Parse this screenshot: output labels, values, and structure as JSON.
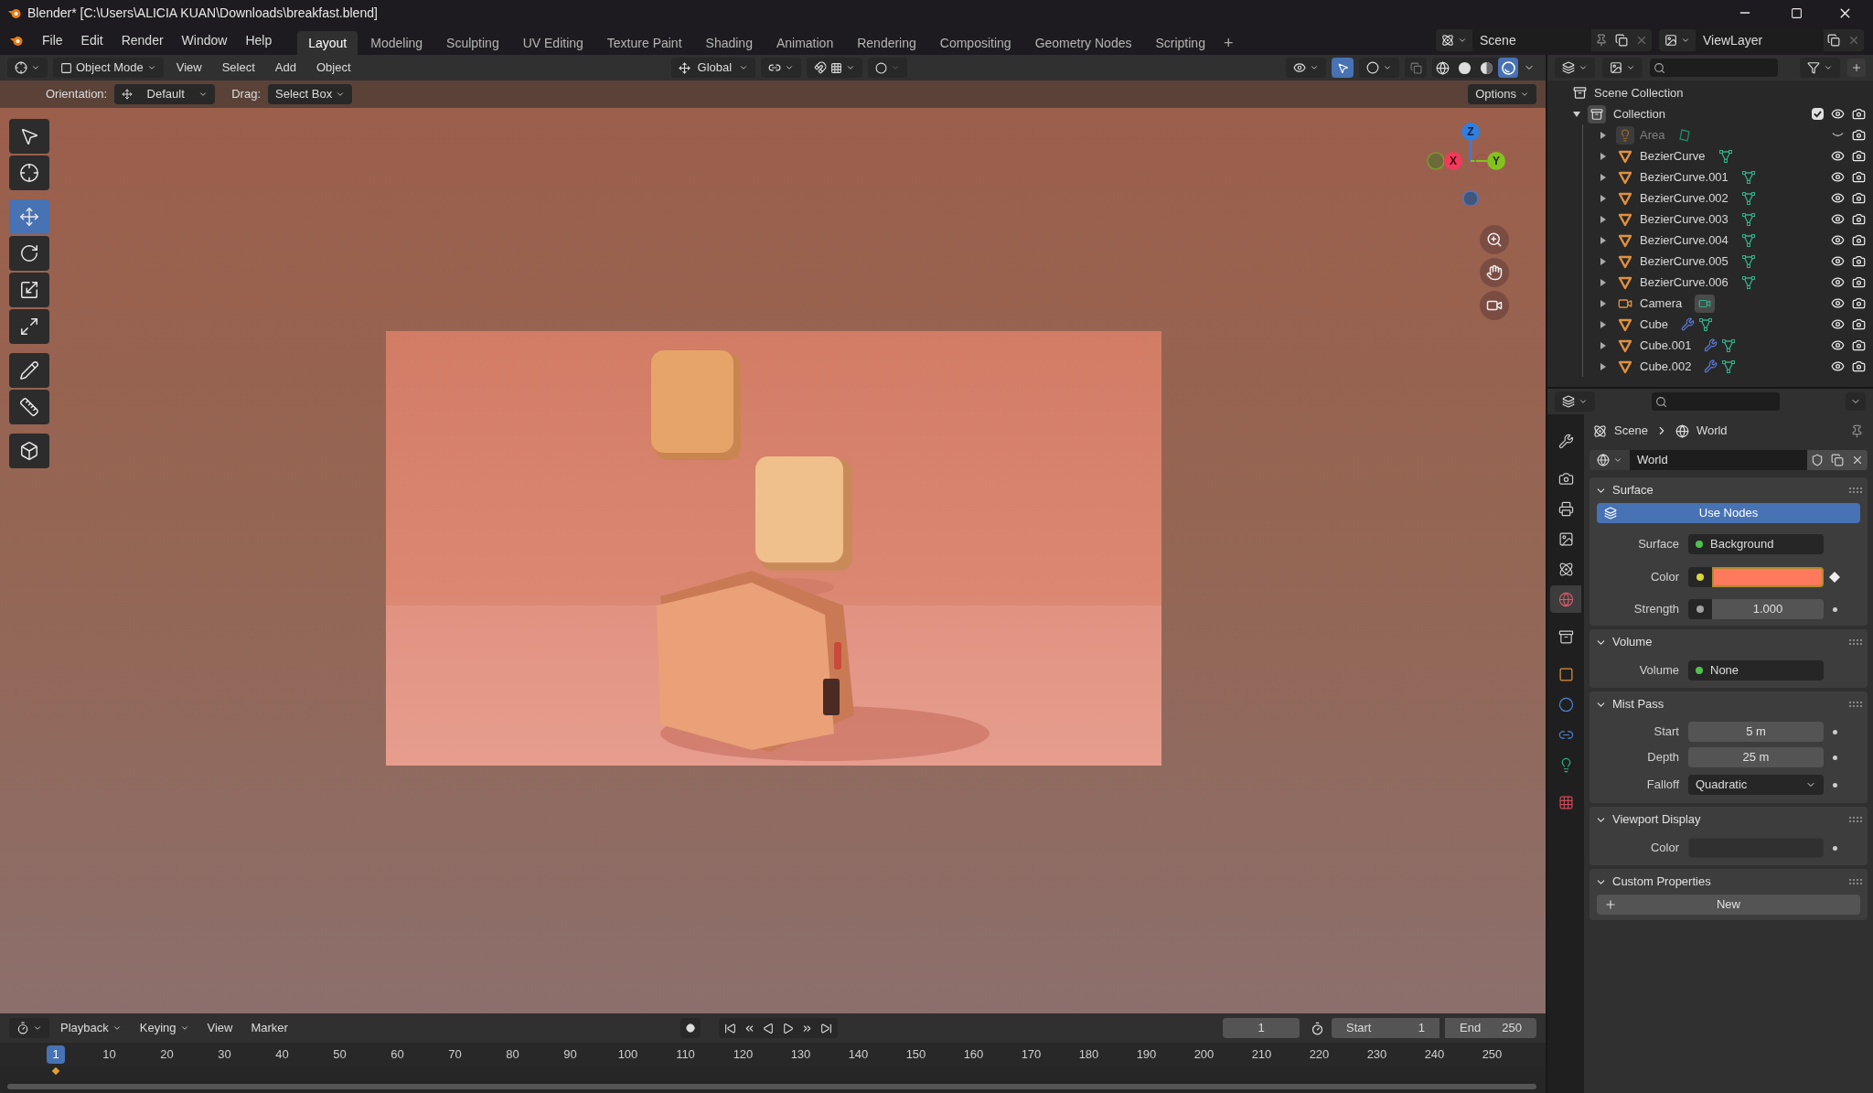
{
  "window": {
    "title": "Blender* [C:\\Users\\ALICIA KUAN\\Downloads\\breakfast.blend]"
  },
  "menu": [
    "File",
    "Edit",
    "Render",
    "Window",
    "Help"
  ],
  "workspaces": [
    {
      "label": "Layout",
      "selected": true
    },
    {
      "label": "Modeling",
      "selected": false
    },
    {
      "label": "Sculpting",
      "selected": false
    },
    {
      "label": "UV Editing",
      "selected": false
    },
    {
      "label": "Texture Paint",
      "selected": false
    },
    {
      "label": "Shading",
      "selected": false
    },
    {
      "label": "Animation",
      "selected": false
    },
    {
      "label": "Rendering",
      "selected": false
    },
    {
      "label": "Compositing",
      "selected": false
    },
    {
      "label": "Geometry Nodes",
      "selected": false
    },
    {
      "label": "Scripting",
      "selected": false
    }
  ],
  "add_workspace": "+",
  "scene": {
    "name": "Scene"
  },
  "view_layer": {
    "name": "ViewLayer"
  },
  "viewport_header": {
    "mode": "Object Mode",
    "menus": [
      "View",
      "Select",
      "Add",
      "Object"
    ],
    "transform": "Global"
  },
  "shading_modes": [
    {
      "kind": "wireframe",
      "selected": false
    },
    {
      "kind": "solid",
      "selected": false
    },
    {
      "kind": "material",
      "selected": false
    },
    {
      "kind": "rendered",
      "selected": true
    }
  ],
  "tool_settings": {
    "orientation_label": "Orientation:",
    "orientation": "Default",
    "drag_label": "Drag:",
    "drag": "Select Box",
    "options": "Options"
  },
  "tools": [
    {
      "kind": "select",
      "selected": false
    },
    {
      "kind": "cursor",
      "selected": false
    },
    {
      "kind": "move",
      "selected": true
    },
    {
      "kind": "rotate",
      "selected": false
    },
    {
      "kind": "scale",
      "selected": false
    },
    {
      "kind": "transform",
      "selected": false
    },
    {
      "kind": "annotate",
      "selected": false
    },
    {
      "kind": "measure",
      "selected": false
    },
    {
      "kind": "add-cube",
      "selected": false
    }
  ],
  "gizmo": {
    "x": "X",
    "y": "Y",
    "z": "Z"
  },
  "outliner": {
    "root": "Scene Collection",
    "collection": {
      "name": "Collection",
      "expanded": true,
      "checked": true,
      "children": [
        {
          "name": "Area",
          "kind": "light",
          "visible": false,
          "modifier": false
        },
        {
          "name": "BezierCurve",
          "kind": "curve",
          "visible": true,
          "modifier": false
        },
        {
          "name": "BezierCurve.001",
          "kind": "curve",
          "visible": true,
          "modifier": false
        },
        {
          "name": "BezierCurve.002",
          "kind": "curve",
          "visible": true,
          "modifier": false
        },
        {
          "name": "BezierCurve.003",
          "kind": "curve",
          "visible": true,
          "modifier": false
        },
        {
          "name": "BezierCurve.004",
          "kind": "curve",
          "visible": true,
          "modifier": false
        },
        {
          "name": "BezierCurve.005",
          "kind": "curve",
          "visible": true,
          "modifier": false
        },
        {
          "name": "BezierCurve.006",
          "kind": "curve",
          "visible": true,
          "modifier": false
        },
        {
          "name": "Camera",
          "kind": "camera",
          "visible": true,
          "modifier": false
        },
        {
          "name": "Cube",
          "kind": "curve",
          "visible": true,
          "modifier": true
        },
        {
          "name": "Cube.001",
          "kind": "curve",
          "visible": true,
          "modifier": true
        },
        {
          "name": "Cube.002",
          "kind": "curve",
          "visible": true,
          "modifier": true
        }
      ]
    }
  },
  "properties": {
    "tabs": [
      {
        "kind": "tool",
        "selected": false
      },
      {
        "kind": "render",
        "selected": false
      },
      {
        "kind": "output",
        "selected": false
      },
      {
        "kind": "view-layer",
        "selected": false
      },
      {
        "kind": "scene",
        "selected": false
      },
      {
        "kind": "world",
        "selected": true
      },
      {
        "kind": "collection",
        "selected": false
      },
      {
        "kind": "object",
        "selected": false
      },
      {
        "kind": "physics",
        "selected": false
      },
      {
        "kind": "constraints",
        "selected": false
      },
      {
        "kind": "data",
        "selected": false
      },
      {
        "kind": "texture",
        "selected": false
      }
    ],
    "breadcrumb": [
      "Scene",
      "World"
    ],
    "datablock": "World",
    "panels": [
      {
        "title": "Surface",
        "expanded": true,
        "rows": [
          {
            "kind": "button",
            "label": "Use Nodes",
            "selected": true
          },
          {
            "kind": "link",
            "label": "Surface",
            "value": "Background",
            "socket": {
              "color": "#4fc14f"
            }
          },
          {
            "kind": "color",
            "label": "Color",
            "color": "#ff7a5c",
            "socket": {
              "color": "#d8d83a"
            },
            "keyframe": true
          },
          {
            "kind": "number",
            "label": "Strength",
            "value": "1.000",
            "socket": {
              "color": "#a1a1a1"
            }
          }
        ]
      },
      {
        "title": "Volume",
        "expanded": true,
        "rows": [
          {
            "kind": "link",
            "label": "Volume",
            "value": "None",
            "socket": {
              "color": "#4fc14f"
            }
          }
        ]
      },
      {
        "title": "Mist Pass",
        "expanded": true,
        "rows": [
          {
            "kind": "number",
            "label": "Start",
            "value": "5 m"
          },
          {
            "kind": "number",
            "label": "Depth",
            "value": "25 m"
          },
          {
            "kind": "menu",
            "label": "Falloff",
            "value": "Quadratic"
          }
        ]
      },
      {
        "title": "Viewport Display",
        "expanded": true,
        "rows": [
          {
            "kind": "color",
            "label": "Color",
            "color": "#303030",
            "keyframe": false
          }
        ]
      },
      {
        "title": "Custom Properties",
        "expanded": true,
        "rows": [
          {
            "kind": "button",
            "label": "New",
            "selected": false
          }
        ]
      }
    ]
  },
  "timeline": {
    "menus": [
      "Playback",
      "Keying",
      "View",
      "Marker"
    ],
    "current_frame": "1",
    "start_label": "Start",
    "start": "1",
    "end_label": "End",
    "end": "250",
    "ticks": [
      {
        "label": "1",
        "selected": true
      },
      {
        "label": "10",
        "selected": false
      },
      {
        "label": "20",
        "selected": false
      },
      {
        "label": "30",
        "selected": false
      },
      {
        "label": "40",
        "selected": false
      },
      {
        "label": "50",
        "selected": false
      },
      {
        "label": "60",
        "selected": false
      },
      {
        "label": "70",
        "selected": false
      },
      {
        "label": "80",
        "selected": false
      },
      {
        "label": "90",
        "selected": false
      },
      {
        "label": "100",
        "selected": false
      },
      {
        "label": "110",
        "selected": false
      },
      {
        "label": "120",
        "selected": false
      },
      {
        "label": "130",
        "selected": false
      },
      {
        "label": "140",
        "selected": false
      },
      {
        "label": "150",
        "selected": false
      },
      {
        "label": "160",
        "selected": false
      },
      {
        "label": "170",
        "selected": false
      },
      {
        "label": "180",
        "selected": false
      },
      {
        "label": "190",
        "selected": false
      },
      {
        "label": "200",
        "selected": false
      },
      {
        "label": "210",
        "selected": false
      },
      {
        "label": "220",
        "selected": false
      },
      {
        "label": "230",
        "selected": false
      },
      {
        "label": "240",
        "selected": false
      },
      {
        "label": "250",
        "selected": false
      }
    ]
  }
}
